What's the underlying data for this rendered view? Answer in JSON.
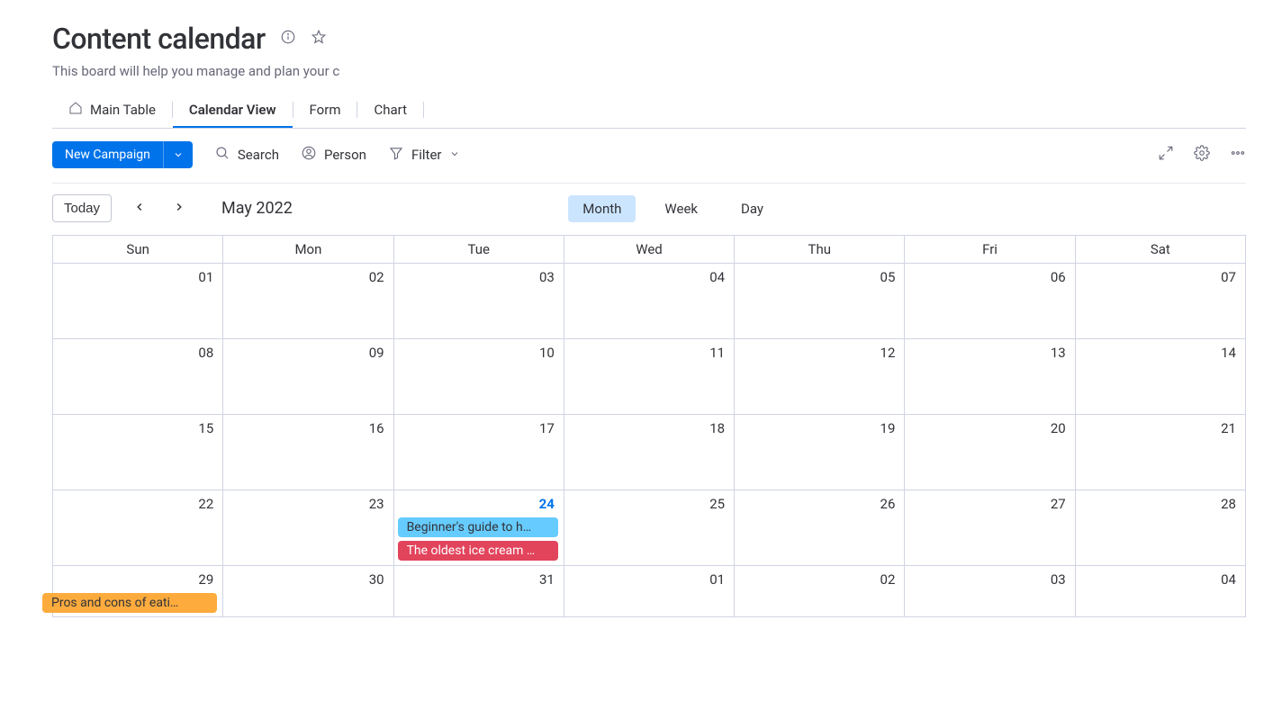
{
  "header": {
    "title": "Content calendar",
    "subtitle": "This board will help you manage and plan your conte"
  },
  "tabs": [
    {
      "label": "Main Table",
      "active": false,
      "icon": true
    },
    {
      "label": "Calendar View",
      "active": true,
      "icon": false
    },
    {
      "label": "Form",
      "active": false,
      "icon": false
    },
    {
      "label": "Chart",
      "active": false,
      "icon": false
    }
  ],
  "toolbar": {
    "new_button": "New Campaign",
    "search": "Search",
    "person": "Person",
    "filter": "Filter"
  },
  "calendar": {
    "today_label": "Today",
    "month_label": "May 2022",
    "views": {
      "month": "Month",
      "week": "Week",
      "day": "Day"
    },
    "day_headers": [
      "Sun",
      "Mon",
      "Tue",
      "Wed",
      "Thu",
      "Fri",
      "Sat"
    ],
    "weeks": [
      [
        {
          "n": "01"
        },
        {
          "n": "02"
        },
        {
          "n": "03"
        },
        {
          "n": "04"
        },
        {
          "n": "05"
        },
        {
          "n": "06"
        },
        {
          "n": "07"
        }
      ],
      [
        {
          "n": "08"
        },
        {
          "n": "09"
        },
        {
          "n": "10"
        },
        {
          "n": "11"
        },
        {
          "n": "12"
        },
        {
          "n": "13"
        },
        {
          "n": "14"
        }
      ],
      [
        {
          "n": "15"
        },
        {
          "n": "16"
        },
        {
          "n": "17"
        },
        {
          "n": "18"
        },
        {
          "n": "19"
        },
        {
          "n": "20"
        },
        {
          "n": "21"
        }
      ],
      [
        {
          "n": "22"
        },
        {
          "n": "23"
        },
        {
          "n": "24",
          "today": true,
          "events": [
            {
              "t": "Beginner's guide to h…",
              "c": "blue"
            },
            {
              "t": "The oldest ice cream …",
              "c": "pink"
            }
          ]
        },
        {
          "n": "25"
        },
        {
          "n": "26"
        },
        {
          "n": "27"
        },
        {
          "n": "28"
        }
      ],
      [
        {
          "n": "29",
          "events": [
            {
              "t": "Pros and cons of eati…",
              "c": "orange"
            }
          ]
        },
        {
          "n": "30"
        },
        {
          "n": "31"
        },
        {
          "n": "01"
        },
        {
          "n": "02"
        },
        {
          "n": "03"
        },
        {
          "n": "04"
        }
      ]
    ]
  }
}
